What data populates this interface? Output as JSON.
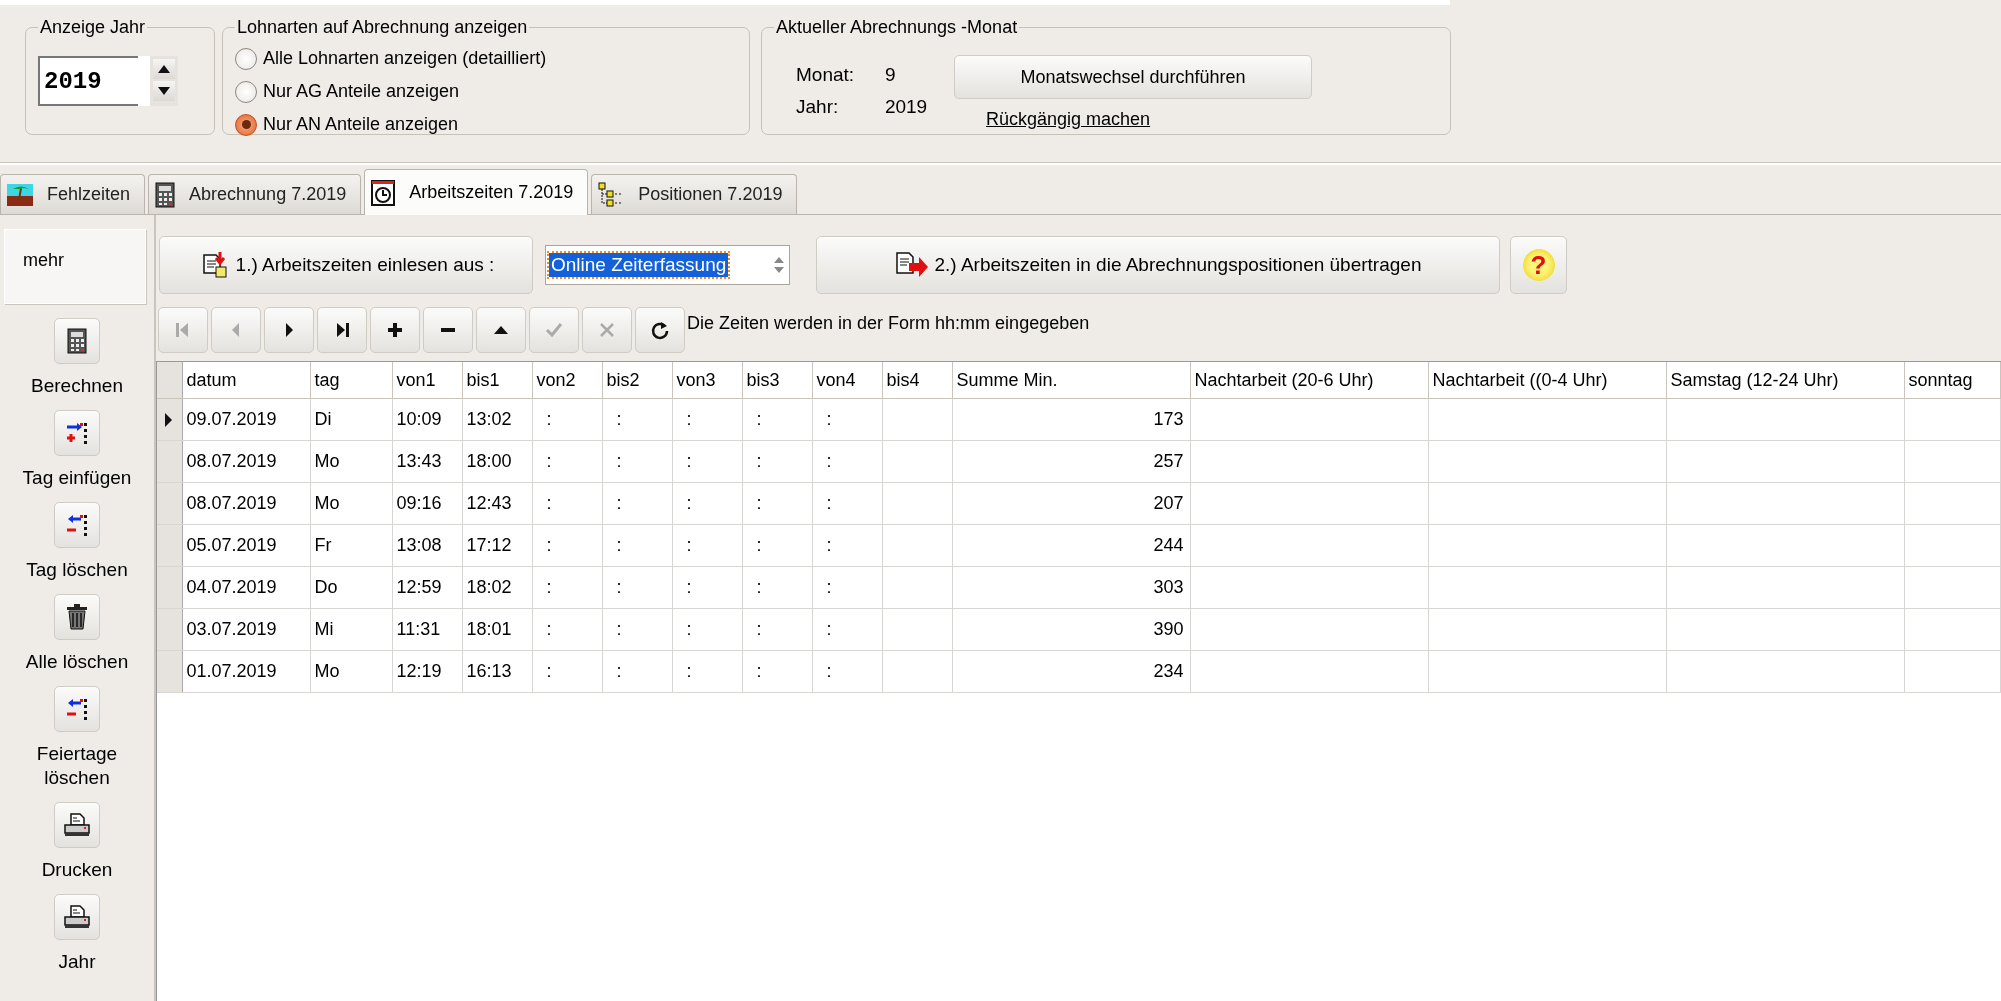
{
  "year_box": {
    "legend": "Anzeige Jahr",
    "value": "2019"
  },
  "wage_types": {
    "legend": "Lohnarten auf Abrechnung anzeigen",
    "options": [
      {
        "label": "Alle Lohnarten anzeigen (detailliert)",
        "selected": false
      },
      {
        "label": "Nur AG Anteile anzeigen",
        "selected": false
      },
      {
        "label": "Nur AN Anteile anzeigen",
        "selected": true
      }
    ]
  },
  "current_month": {
    "legend": "Aktueller Abrechnungs -Monat",
    "month_label": "Monat:",
    "month": "9",
    "year_label": "Jahr:",
    "year": "2019",
    "button": "Monatswechsel durchführen",
    "link": "Rückgängig machen"
  },
  "tabs": [
    {
      "label": "Fehlzeiten",
      "kind": "beach",
      "selected": false
    },
    {
      "label": "Abrechnung 7.2019",
      "kind": "calculator",
      "selected": false
    },
    {
      "label": "Arbeitszeiten 7.2019",
      "kind": "clock",
      "selected": true
    },
    {
      "label": "Positionen 7.2019",
      "kind": "tree",
      "selected": false
    }
  ],
  "sidebar": {
    "header": "mehr",
    "items": [
      {
        "label": "Berechnen",
        "kind": "calculator"
      },
      {
        "label": "Tag einfügen",
        "kind": "insert"
      },
      {
        "label": "Tag löschen",
        "kind": "remove"
      },
      {
        "label": "Alle löschen",
        "kind": "trash"
      },
      {
        "label": "Feiertage löschen",
        "kind": "remove"
      },
      {
        "label": "Drucken",
        "kind": "printer"
      },
      {
        "label": "Jahr",
        "kind": "printer"
      }
    ]
  },
  "import_button": "1.) Arbeitszeiten einlesen aus :",
  "source_select": "Online Zeiterfassung",
  "transfer_button": "2.) Arbeitszeiten in die Abrechnungspositionen übertragen",
  "help_button": "?",
  "nav_buttons": [
    {
      "kind": "first",
      "disabled": true
    },
    {
      "kind": "prev",
      "disabled": true
    },
    {
      "kind": "next",
      "disabled": false
    },
    {
      "kind": "last",
      "disabled": false
    },
    {
      "kind": "add",
      "disabled": false
    },
    {
      "kind": "delete",
      "disabled": false
    },
    {
      "kind": "edit",
      "disabled": false
    },
    {
      "kind": "post",
      "disabled": true
    },
    {
      "kind": "cancel",
      "disabled": true
    },
    {
      "kind": "refresh",
      "disabled": false
    }
  ],
  "hint": "Die Zeiten werden in der Form hh:mm eingegeben",
  "table": {
    "columns": [
      "datum",
      "tag",
      "von1",
      "bis1",
      "von2",
      "bis2",
      "von3",
      "bis3",
      "von4",
      "bis4",
      "Summe Min.",
      "Nachtarbeit (20-6 Uhr)",
      "Nachtarbeit ((0-4 Uhr)",
      "Samstag (12-24 Uhr)",
      "sonntag"
    ],
    "rows": [
      {
        "current": true,
        "cells": [
          "09.07.2019",
          "Di",
          "10:09",
          "13:02",
          ":",
          ":",
          ":",
          ":",
          ":",
          null,
          "173"
        ]
      },
      {
        "current": false,
        "cells": [
          "08.07.2019",
          "Mo",
          "13:43",
          "18:00",
          ":",
          ":",
          ":",
          ":",
          ":",
          null,
          "257"
        ]
      },
      {
        "current": false,
        "cells": [
          "08.07.2019",
          "Mo",
          "09:16",
          "12:43",
          ":",
          ":",
          ":",
          ":",
          ":",
          null,
          "207"
        ]
      },
      {
        "current": false,
        "cells": [
          "05.07.2019",
          "Fr",
          "13:08",
          "17:12",
          ":",
          ":",
          ":",
          ":",
          ":",
          null,
          "244"
        ]
      },
      {
        "current": false,
        "cells": [
          "04.07.2019",
          "Do",
          "12:59",
          "18:02",
          ":",
          ":",
          ":",
          ":",
          ":",
          null,
          "303"
        ]
      },
      {
        "current": false,
        "cells": [
          "03.07.2019",
          "Mi",
          "11:31",
          "18:01",
          ":",
          ":",
          ":",
          ":",
          ":",
          null,
          "390"
        ]
      },
      {
        "current": false,
        "cells": [
          "01.07.2019",
          "Mo",
          "12:19",
          "16:13",
          ":",
          ":",
          ":",
          ":",
          ":",
          null,
          "234"
        ]
      }
    ]
  }
}
